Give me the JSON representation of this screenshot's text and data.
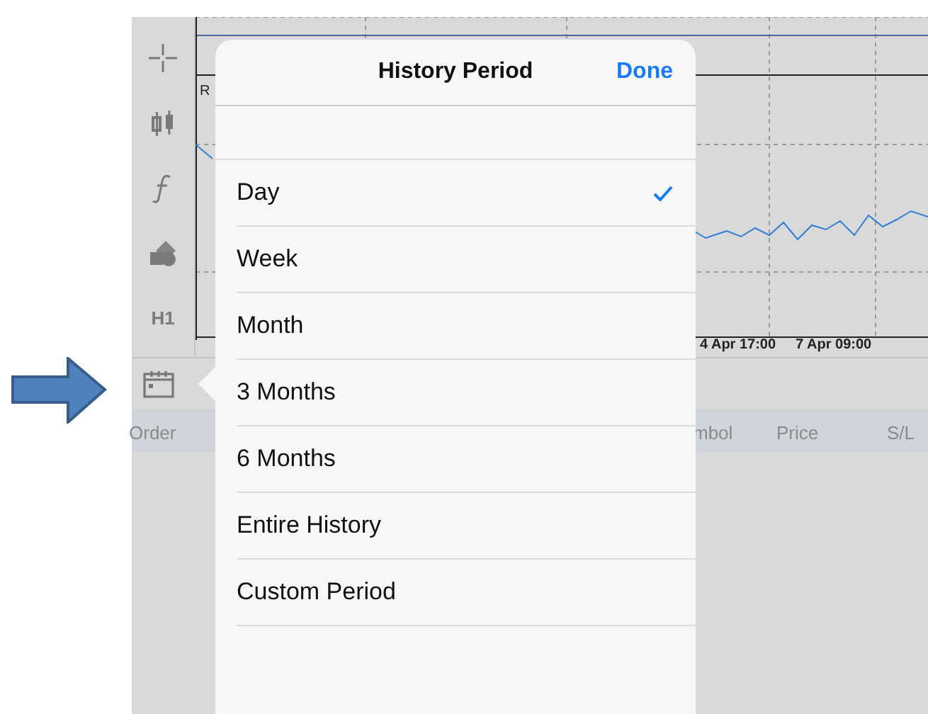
{
  "toolbar": {
    "timeframe": "H1"
  },
  "chart": {
    "indicator_label": "R",
    "time_labels": [
      "4 Apr 17:00",
      "7 Apr 09:00"
    ]
  },
  "table": {
    "columns": [
      "Order",
      "mbol",
      "Price",
      "S/L"
    ]
  },
  "popover": {
    "title": "History Period",
    "done": "Done",
    "items": [
      {
        "label": "Day",
        "selected": true
      },
      {
        "label": "Week",
        "selected": false
      },
      {
        "label": "Month",
        "selected": false
      },
      {
        "label": "3 Months",
        "selected": false
      },
      {
        "label": "6 Months",
        "selected": false
      },
      {
        "label": "Entire History",
        "selected": false
      },
      {
        "label": "Custom Period",
        "selected": false
      }
    ]
  }
}
